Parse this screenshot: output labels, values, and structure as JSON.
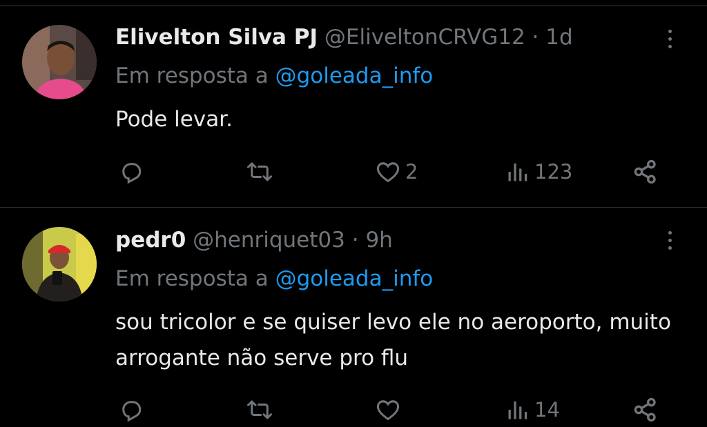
{
  "tweets": [
    {
      "name": "Elivelton Silva PJ",
      "handle": "@EliveltonCRVG12",
      "separator": "·",
      "time": "1d",
      "reply_prefix": "Em resposta a",
      "reply_mention": "@goleada_info",
      "text": "Pode levar.",
      "counts": {
        "replies": "",
        "retweets": "",
        "likes": "2",
        "views": "123"
      }
    },
    {
      "name": "pedr0",
      "handle": "@henriquet03",
      "separator": "·",
      "time": "9h",
      "reply_prefix": "Em resposta a",
      "reply_mention": "@goleada_info",
      "text": "sou tricolor e se quiser levo ele no aeroporto, muito arrogante não serve pro flu",
      "counts": {
        "replies": "",
        "retweets": "",
        "likes": "",
        "views": "14"
      }
    }
  ],
  "icons": {
    "reply": "reply-icon",
    "retweet": "retweet-icon",
    "like": "heart-icon",
    "views": "views-icon",
    "share": "share-icon",
    "more": "more-icon"
  },
  "colors": {
    "background": "#000000",
    "text_primary": "#e7e9ea",
    "text_secondary": "#71767b",
    "mention": "#1d9bf0",
    "divider": "#2f3336"
  }
}
